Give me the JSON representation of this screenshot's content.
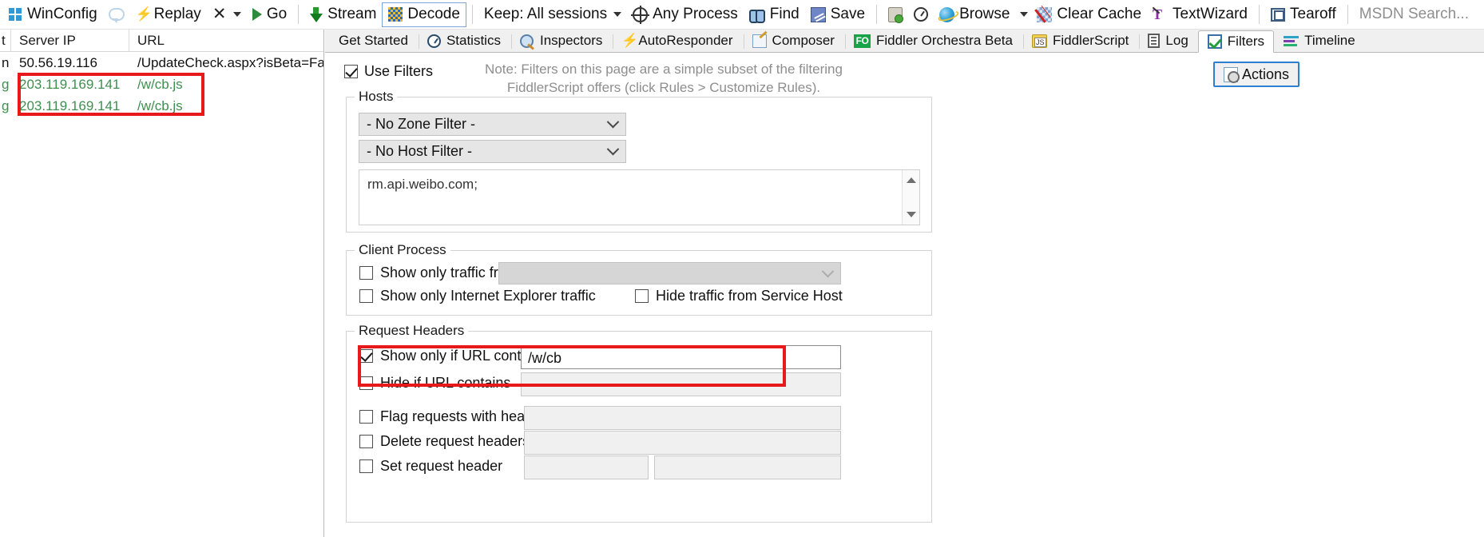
{
  "toolbar": {
    "items": [
      {
        "label": "WinConfig",
        "icon": "windows-icon"
      },
      {
        "label": "",
        "icon": "comment-bubble-icon"
      },
      {
        "label": "Replay",
        "icon": "replay-icon"
      },
      {
        "label": "",
        "icon": "remove-x-icon"
      },
      {
        "label": "Go",
        "icon": "play-icon"
      },
      {
        "label": "Stream",
        "icon": "stream-icon"
      },
      {
        "label": "Decode",
        "icon": "decode-icon"
      },
      {
        "label": "Keep: All sessions",
        "icon": ""
      },
      {
        "label": "Any Process",
        "icon": "target-icon"
      },
      {
        "label": "Find",
        "icon": "binoculars-icon"
      },
      {
        "label": "Save",
        "icon": "save-icon"
      },
      {
        "label": "",
        "icon": "clipboard-icon"
      },
      {
        "label": "",
        "icon": "timer-icon"
      },
      {
        "label": "Browse",
        "icon": "internet-explorer-icon"
      },
      {
        "label": "Clear Cache",
        "icon": "clear-cache-icon"
      },
      {
        "label": "TextWizard",
        "icon": "textwizard-icon"
      },
      {
        "label": "Tearoff",
        "icon": "tearoff-icon"
      },
      {
        "label": "MSDN Search...",
        "icon": ""
      }
    ],
    "winconfig": "WinConfig",
    "replay": "Replay",
    "go": "Go",
    "stream": "Stream",
    "decode": "Decode",
    "keep": "Keep: All sessions",
    "any_process": "Any Process",
    "find": "Find",
    "save": "Save",
    "browse": "Browse",
    "clear_cache": "Clear Cache",
    "textwizard": "TextWizard",
    "tearoff": "Tearoff",
    "msdn_search": "MSDN Search..."
  },
  "sessions": {
    "columns": [
      "t",
      "Server IP",
      "URL"
    ],
    "col0_header": "t",
    "col1_header": "Server IP",
    "col2_header": "URL",
    "rows": [
      {
        "flag": "n",
        "server_ip": "50.56.19.116",
        "url": "/UpdateCheck.aspx?isBeta=Fa...",
        "color": "black"
      },
      {
        "flag": "g",
        "server_ip": "203.119.169.141",
        "url": "/w/cb.js",
        "color": "green"
      },
      {
        "flag": "g",
        "server_ip": "203.119.169.141",
        "url": "/w/cb.js",
        "color": "green"
      }
    ]
  },
  "tabs": [
    {
      "label": "Get Started",
      "icon": "",
      "active": false
    },
    {
      "label": "Statistics",
      "icon": "statistics-icon",
      "active": false
    },
    {
      "label": "Inspectors",
      "icon": "inspectors-icon",
      "active": false
    },
    {
      "label": "AutoResponder",
      "icon": "autoresponder-icon",
      "active": false
    },
    {
      "label": "Composer",
      "icon": "composer-icon",
      "active": false
    },
    {
      "label": "Fiddler Orchestra Beta",
      "icon": "fiddler-orchestra-icon",
      "active": false
    },
    {
      "label": "FiddlerScript",
      "icon": "fiddlerscript-icon",
      "active": false
    },
    {
      "label": "Log",
      "icon": "log-icon",
      "active": false
    },
    {
      "label": "Filters",
      "icon": "filters-icon",
      "active": true
    },
    {
      "label": "Timeline",
      "icon": "timeline-icon",
      "active": false
    }
  ],
  "filters": {
    "use_filters_label": "Use Filters",
    "use_filters_checked": true,
    "note_line1": "Note: Filters on this page are a simple subset of the filtering",
    "note_line2": "FiddlerScript offers (click Rules > Customize Rules).",
    "actions_label": "Actions",
    "hosts": {
      "title": "Hosts",
      "zone_filter": "- No Zone Filter -",
      "host_filter": "- No Host Filter -",
      "hosts_text": "rm.api.weibo.com;"
    },
    "client_process": {
      "title": "Client Process",
      "show_only_traffic_from_label": "Show only traffic from",
      "show_only_traffic_from_checked": false,
      "show_only_traffic_from_value": "",
      "show_only_ie_label": "Show only Internet Explorer traffic",
      "show_only_ie_checked": false,
      "hide_service_host_label": "Hide traffic from Service Host",
      "hide_service_host_checked": false
    },
    "request_headers": {
      "title": "Request Headers",
      "show_only_if_url_contains_label": "Show only if URL contains",
      "show_only_if_url_contains_checked": true,
      "show_only_if_url_contains_value": "/w/cb",
      "hide_if_url_contains_label": "Hide if URL contains",
      "hide_if_url_contains_checked": false,
      "hide_if_url_contains_value": "",
      "flag_requests_label": "Flag requests with headers",
      "flag_requests_checked": false,
      "flag_requests_value": "",
      "delete_request_headers_label": "Delete request headers",
      "delete_request_headers_checked": false,
      "delete_request_headers_value": "",
      "set_request_header_label": "Set request header",
      "set_request_header_checked": false,
      "set_request_header_name": "",
      "set_request_header_value": ""
    }
  },
  "colors": {
    "highlight": "#e8191b",
    "accent": "#2f7fd0",
    "green_row": "#3f8f4f"
  }
}
